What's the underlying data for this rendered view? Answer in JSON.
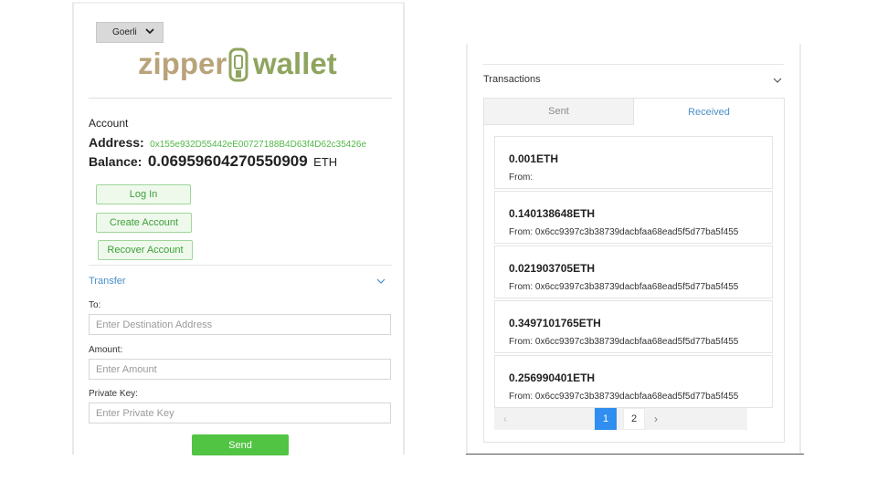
{
  "network": {
    "selected": "Goerli"
  },
  "logo": {
    "left_text": "zipper",
    "right_text": "wallet",
    "color": "#8fa55f"
  },
  "account": {
    "heading": "Account",
    "address_label": "Address:",
    "address_value": "0x155e932D55442eE00727188B4D63f4D62c35426e",
    "balance_label": "Balance:",
    "balance_value": "0.06959604270550909",
    "balance_unit": "ETH"
  },
  "buttons": {
    "login": "Log In",
    "create": "Create Account",
    "recover": "Recover Account"
  },
  "transfer": {
    "header": "Transfer",
    "to_label": "To:",
    "to_placeholder": "Enter Destination Address",
    "amount_label": "Amount:",
    "amount_placeholder": "Enter Amount",
    "key_label": "Private Key:",
    "key_placeholder": "Enter Private Key",
    "send_label": "Send"
  },
  "transactions": {
    "header": "Transactions",
    "tabs": {
      "sent": "Sent",
      "received": "Received"
    },
    "items": [
      {
        "amount": "0.001ETH",
        "from": "From:"
      },
      {
        "amount": "0.140138648ETH",
        "from": "From: 0x6cc9397c3b38739dacbfaa68ead5f5d77ba5f455"
      },
      {
        "amount": "0.021903705ETH",
        "from": "From: 0x6cc9397c3b38739dacbfaa68ead5f5d77ba5f455"
      },
      {
        "amount": "0.3497101765ETH",
        "from": "From: 0x6cc9397c3b38739dacbfaa68ead5f5d77ba5f455"
      },
      {
        "amount": "0.256990401ETH",
        "from": "From: 0x6cc9397c3b38739dacbfaa68ead5f5d77ba5f455"
      }
    ],
    "pagination": {
      "prev": "‹",
      "pages": [
        "1",
        "2"
      ],
      "current": "1",
      "next": "›"
    }
  },
  "colors": {
    "accent_green": "#52c443",
    "link_blue": "#4a8fc7",
    "active_page": "#2f8ef0",
    "address_green": "#52b848"
  }
}
